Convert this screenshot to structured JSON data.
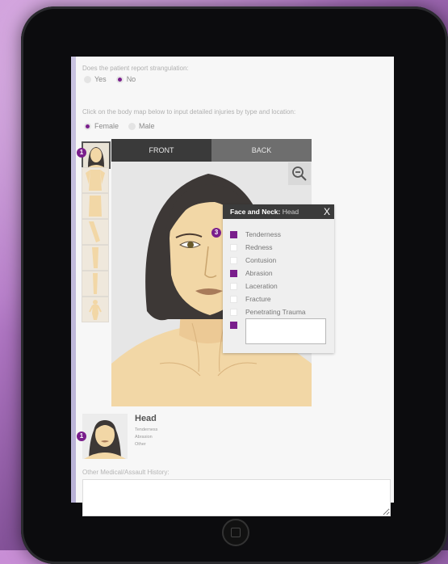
{
  "form": {
    "strangulation_question": "Does the patient report strangulation:",
    "strangulation_options": [
      {
        "label": "Yes",
        "selected": false
      },
      {
        "label": "No",
        "selected": true
      }
    ],
    "bodymap_instruction": "Click on the body map below to input detailed injuries by type and location:",
    "sex_options": [
      {
        "label": "Female",
        "selected": true
      },
      {
        "label": "Male",
        "selected": false
      }
    ]
  },
  "bodymap": {
    "tabs": [
      {
        "label": "FRONT",
        "active": true
      },
      {
        "label": "BACK",
        "active": false
      }
    ],
    "thumb_badge": "1",
    "zoom_icon": "zoom-out-icon"
  },
  "popup": {
    "region": "Face and Neck:",
    "subregion": "Head",
    "close_label": "X",
    "badge": "3",
    "options": [
      {
        "label": "Tenderness",
        "checked": true
      },
      {
        "label": "Redness",
        "checked": false
      },
      {
        "label": "Contusion",
        "checked": false
      },
      {
        "label": "Abrasion",
        "checked": true
      },
      {
        "label": "Laceration",
        "checked": false
      },
      {
        "label": "Fracture",
        "checked": false
      },
      {
        "label": "Penetrating Trauma",
        "checked": false
      }
    ],
    "other_checked": true,
    "other_value": ""
  },
  "summary": {
    "badge": "1",
    "title": "Head",
    "items": [
      "Tenderness",
      "Abrasion",
      "Other"
    ]
  },
  "history": {
    "label": "Other Medical/Assault History:",
    "value": ""
  },
  "colors": {
    "accent": "#7a1e8c",
    "tab_front": "#3a3a3a",
    "tab_back": "#6e6e6e",
    "skin": "#f2d7a6",
    "hair": "#3d3836"
  }
}
